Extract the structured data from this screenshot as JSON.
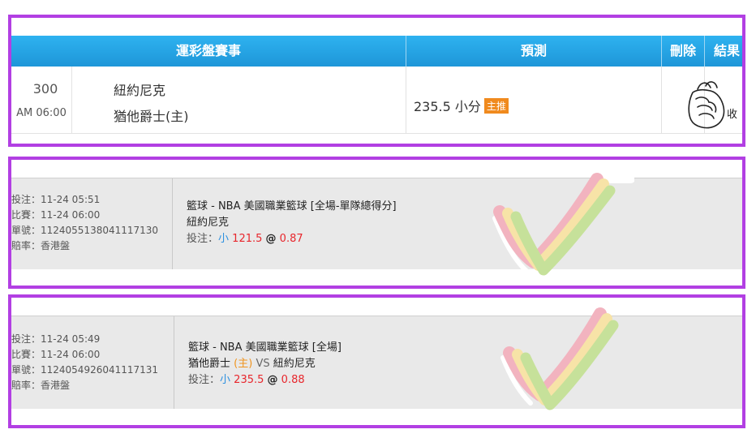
{
  "panel1": {
    "headers": {
      "event": "運彩盤賽事",
      "prediction": "預測",
      "delete": "刪除",
      "result": "結果"
    },
    "row": {
      "number": "300",
      "time": "AM 06:00",
      "team_away": "紐約尼克",
      "team_home": "猶他爵士(主)",
      "prediction_value": "235.5 小分",
      "prediction_badge": "主推",
      "result_text": "收"
    }
  },
  "bets": [
    {
      "bet_time": "投注：11-24 05:51",
      "match_time": "比賽：11-24 06:00",
      "order_no": "單號：1124055138041117130",
      "odds_type": "賠率：香港盤",
      "league": "籃球 - NBA 美國職業籃球 [全場-單隊總得分]",
      "teams": "紐約尼克",
      "bet_label": "投注：",
      "pick": "小",
      "line": "121.5",
      "at": "@",
      "odds": "0.87"
    },
    {
      "bet_time": "投注：11-24 05:49",
      "match_time": "比賽：11-24 06:00",
      "order_no": "單號：1124054926041117131",
      "odds_type": "賠率：香港盤",
      "league": "籃球 - NBA 美國職業籃球 [全場]",
      "home_team": "猶他爵士",
      "home_mark": "(主)",
      "vs": "VS",
      "away_team": "紐約尼克",
      "bet_label": "投注：",
      "pick": "小",
      "line": "235.5",
      "at": "@",
      "odds": "0.88"
    }
  ],
  "colors": {
    "frame": "#b23fe3",
    "header_blue": "#1e96d8",
    "badge_orange": "#f08a1e",
    "odds_red": "#e8262c",
    "pick_blue": "#2b8fe0"
  },
  "icons": {
    "result": "fist-icon",
    "win_mark": "rainbow-checkmark-icon"
  }
}
